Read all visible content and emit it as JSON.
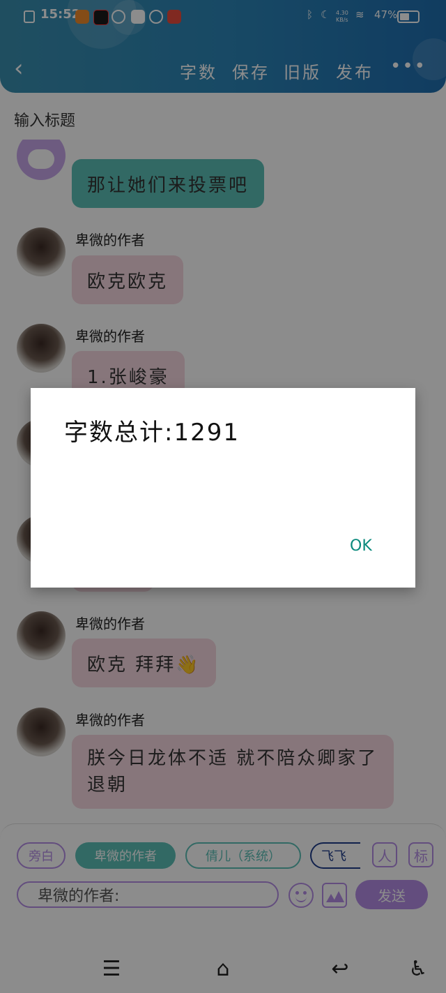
{
  "status_bar": {
    "time": "15:52",
    "network_speed": "4.30 KB/s",
    "battery": "47%"
  },
  "header": {
    "actions": [
      "字数",
      "保存",
      "旧版",
      "发布"
    ],
    "more": "•••"
  },
  "title_placeholder": "输入标题",
  "messages": [
    {
      "sender": "",
      "text": "那让她们来投票吧",
      "style": "teal",
      "avatar": "bot"
    },
    {
      "sender": "卑微的作者",
      "text": "欧克欧克",
      "style": "pink",
      "avatar": "photo"
    },
    {
      "sender": "卑微的作者",
      "text": "1.张峻豪",
      "style": "pink",
      "avatar": "photo"
    },
    {
      "sender": "卑微的作者",
      "text": "欧克 拜拜👋",
      "style": "pink",
      "avatar": "photo"
    },
    {
      "sender": "卑微的作者",
      "text": "朕今日龙体不适 就不陪众卿家了 退朝",
      "style": "pink",
      "avatar": "photo"
    }
  ],
  "role_chips": [
    "旁白",
    "卑微的作者",
    "倩儿（系统）",
    "飞飞"
  ],
  "input": {
    "prefix": "卑微的作者:",
    "send_label": "发送"
  },
  "side_buttons": [
    "人",
    "标"
  ],
  "dialog": {
    "message": "字数总计:1291",
    "ok_label": "OK"
  },
  "nav": {
    "menu": "☰",
    "home": "⌂",
    "back": "↩",
    "accessibility": "♿"
  }
}
